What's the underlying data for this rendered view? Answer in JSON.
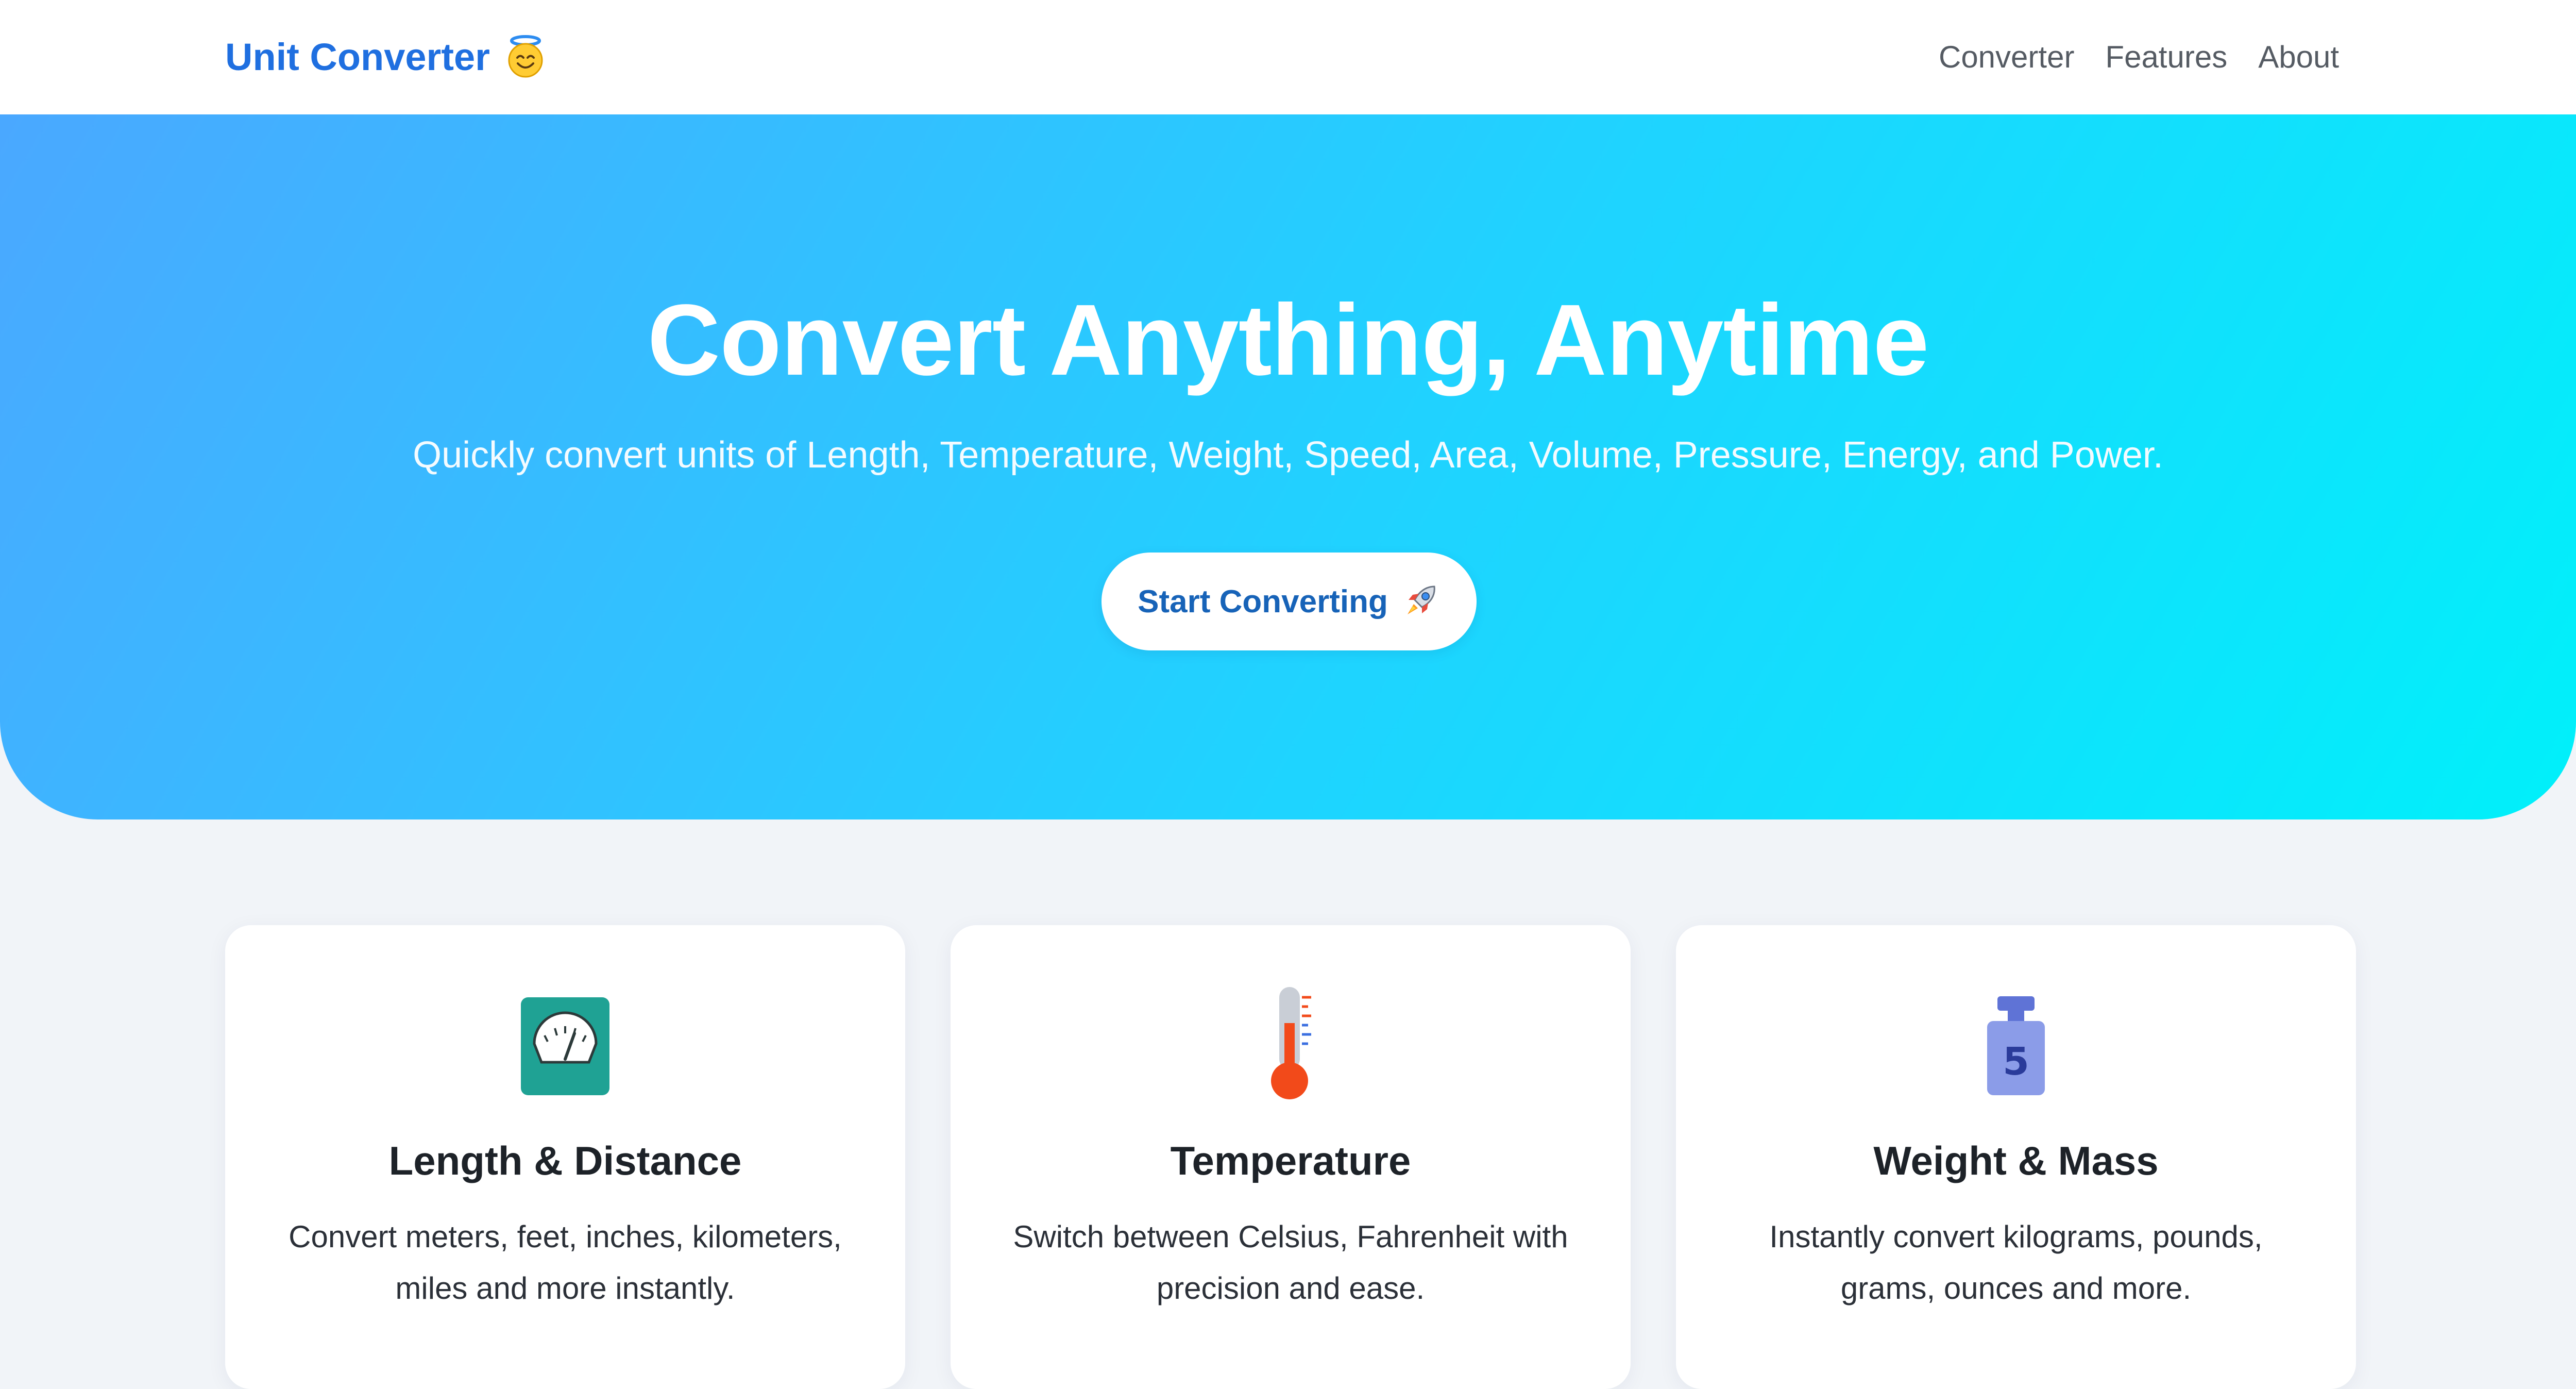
{
  "navbar": {
    "brand": "Unit Converter",
    "brand_emoji": "smiling-face-with-halo-icon",
    "links": [
      "Converter",
      "Features",
      "About"
    ]
  },
  "hero": {
    "title": "Convert Anything, Anytime",
    "subtitle": "Quickly convert units of Length, Temperature, Weight, Speed, Area, Volume, Pressure, Energy, and Power.",
    "cta_label": "Start Converting",
    "cta_icon": "rocket-icon"
  },
  "features": [
    {
      "icon": "scale-gauge-icon",
      "title": "Length & Distance",
      "description": "Convert meters, feet, inches, kilometers, miles and more instantly."
    },
    {
      "icon": "thermometer-icon",
      "title": "Temperature",
      "description": "Switch between Celsius, Fahrenheit with precision and ease."
    },
    {
      "icon": "weight-5-icon",
      "title": "Weight & Mass",
      "description": "Instantly convert kilograms, pounds, grams, ounces and more."
    }
  ],
  "colors": {
    "brand": "#1f6fe0",
    "hero_gradient_start": "#4aa8ff",
    "hero_gradient_end": "#00f0fa",
    "cta_text": "#1763b8",
    "page_background": "#f1f4f8"
  }
}
